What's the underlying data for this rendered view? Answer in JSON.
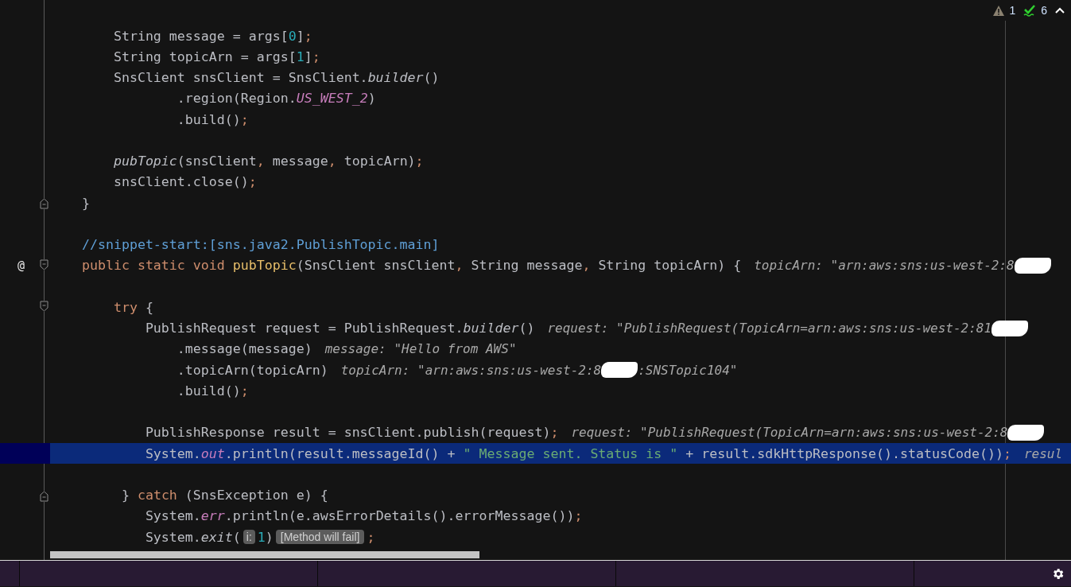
{
  "status": {
    "warnings": "1",
    "checks": "6"
  },
  "blocks": [
    {
      "lines": [
        {
          "segments": [
            {
              "kind": "code",
              "tokens": [
                {
                  "text": "        String message = args[",
                  "kind": "plain"
                },
                {
                  "text": "0",
                  "kind": "number"
                },
                {
                  "text": "]",
                  "kind": "plain"
                },
                {
                  "text": ";",
                  "kind": "punct"
                }
              ]
            }
          ]
        },
        {
          "segments": [
            {
              "kind": "code",
              "tokens": [
                {
                  "text": "        String topicArn = args[",
                  "kind": "plain"
                },
                {
                  "text": "1",
                  "kind": "number"
                },
                {
                  "text": "]",
                  "kind": "plain"
                },
                {
                  "text": ";",
                  "kind": "punct"
                }
              ]
            }
          ]
        },
        {
          "segments": [
            {
              "kind": "code",
              "tokens": [
                {
                  "text": "        SnsClient snsClient = SnsClient.",
                  "kind": "plain"
                },
                {
                  "text": "builder",
                  "kind": "call"
                },
                {
                  "text": "()",
                  "kind": "plain"
                }
              ]
            }
          ]
        },
        {
          "segments": [
            {
              "kind": "code",
              "tokens": [
                {
                  "text": "                .region(Region.",
                  "kind": "plain"
                },
                {
                  "text": "US_WEST_2",
                  "kind": "field"
                },
                {
                  "text": ")",
                  "kind": "plain"
                }
              ]
            }
          ]
        },
        {
          "segments": [
            {
              "kind": "code",
              "tokens": [
                {
                  "text": "                .build()",
                  "kind": "plain"
                },
                {
                  "text": ";",
                  "kind": "punct"
                }
              ]
            }
          ]
        }
      ]
    },
    {
      "lines": [
        {
          "segments": [
            {
              "kind": "code",
              "tokens": [
                {
                  "text": "        pubTopic",
                  "kind": "call"
                },
                {
                  "text": "(snsClient",
                  "kind": "plain"
                },
                {
                  "text": ",",
                  "kind": "punct"
                },
                {
                  "text": " message",
                  "kind": "plain"
                },
                {
                  "text": ",",
                  "kind": "punct"
                },
                {
                  "text": " topicArn)",
                  "kind": "plain"
                },
                {
                  "text": ";",
                  "kind": "punct"
                }
              ]
            }
          ]
        },
        {
          "segments": [
            {
              "kind": "code",
              "tokens": [
                {
                  "text": "        snsClient.close()",
                  "kind": "plain"
                },
                {
                  "text": ";",
                  "kind": "punct"
                }
              ]
            }
          ]
        },
        {
          "marker": {
            "kind": "fold_end"
          },
          "segments": [
            {
              "kind": "code",
              "tokens": [
                {
                  "text": "    }",
                  "kind": "plain"
                }
              ]
            }
          ]
        }
      ]
    },
    {
      "lines": [
        {
          "segments": [
            {
              "kind": "code",
              "tokens": [
                {
                  "text": "    //snippet-start:[sns.java2.PublishTopic.main]",
                  "kind": "comment"
                }
              ]
            }
          ]
        },
        {
          "marker": {
            "kind": "fold_start"
          },
          "gutter": "@",
          "segments": [
            {
              "kind": "code",
              "tokens": [
                {
                  "text": "    public static void ",
                  "kind": "keyword"
                },
                {
                  "text": "pubTopic",
                  "kind": "declaration"
                },
                {
                  "text": "(SnsClient snsClient",
                  "kind": "plain"
                },
                {
                  "text": ",",
                  "kind": "punct"
                },
                {
                  "text": " String message",
                  "kind": "plain"
                },
                {
                  "text": ",",
                  "kind": "punct"
                },
                {
                  "text": " String topicArn) {",
                  "kind": "plain"
                }
              ]
            },
            {
              "kind": "hint",
              "text": "topicArn: \"arn:aws:sns:us-west-2:8"
            },
            {
              "kind": "redaction"
            }
          ]
        }
      ]
    },
    {
      "lines": [
        {
          "marker": {
            "kind": "fold_start"
          },
          "segments": [
            {
              "kind": "code",
              "tokens": [
                {
                  "text": "        try ",
                  "kind": "keyword"
                },
                {
                  "text": "{",
                  "kind": "plain"
                }
              ]
            }
          ]
        },
        {
          "segments": [
            {
              "kind": "code",
              "tokens": [
                {
                  "text": "            PublishRequest request = PublishRequest.",
                  "kind": "plain"
                },
                {
                  "text": "builder",
                  "kind": "call"
                },
                {
                  "text": "()",
                  "kind": "plain"
                }
              ]
            },
            {
              "kind": "hint",
              "text": "request: \"PublishRequest(TopicArn=arn:aws:sns:us-west-2:81"
            },
            {
              "kind": "redaction"
            }
          ]
        },
        {
          "segments": [
            {
              "kind": "code",
              "tokens": [
                {
                  "text": "                .message(message)",
                  "kind": "plain"
                }
              ]
            },
            {
              "kind": "hint",
              "text": "message: \"Hello from AWS\""
            }
          ]
        },
        {
          "segments": [
            {
              "kind": "code",
              "tokens": [
                {
                  "text": "                .topicArn(topicArn)",
                  "kind": "plain"
                }
              ]
            },
            {
              "kind": "hint",
              "text": "topicArn: \"arn:aws:sns:us-west-2:8"
            },
            {
              "kind": "redaction"
            },
            {
              "kind": "hint",
              "text": ":SNSTopic104\""
            }
          ]
        },
        {
          "segments": [
            {
              "kind": "code",
              "tokens": [
                {
                  "text": "                .build()",
                  "kind": "plain"
                },
                {
                  "text": ";",
                  "kind": "punct"
                }
              ]
            }
          ]
        }
      ]
    },
    {
      "lines": [
        {
          "segments": [
            {
              "kind": "code",
              "tokens": [
                {
                  "text": "            PublishResponse result = snsClient.publish(request)",
                  "kind": "plain"
                },
                {
                  "text": ";",
                  "kind": "punct"
                }
              ]
            },
            {
              "kind": "hint",
              "text": "request: \"PublishRequest(TopicArn=arn:aws:sns:us-west-2:8"
            },
            {
              "kind": "redaction"
            }
          ]
        },
        {
          "highlighted": true,
          "segments": [
            {
              "kind": "code",
              "tokens": [
                {
                  "text": "            System.",
                  "kind": "plain"
                },
                {
                  "text": "out",
                  "kind": "field"
                },
                {
                  "text": ".println(result.messageId() + ",
                  "kind": "plain"
                },
                {
                  "text": "\" Message sent. Status is \"",
                  "kind": "string"
                },
                {
                  "text": " + result.sdkHttpResponse().statusCode())",
                  "kind": "plain"
                },
                {
                  "text": ";",
                  "kind": "punct"
                }
              ]
            },
            {
              "kind": "hint",
              "text": "resul"
            }
          ]
        }
      ]
    },
    {
      "lines": [
        {
          "marker": {
            "kind": "fold_end"
          },
          "segments": [
            {
              "kind": "code",
              "tokens": [
                {
                  "text": "         } ",
                  "kind": "plain"
                },
                {
                  "text": "catch ",
                  "kind": "keyword"
                },
                {
                  "text": "(SnsException e) {",
                  "kind": "plain"
                }
              ]
            }
          ]
        },
        {
          "segments": [
            {
              "kind": "code",
              "tokens": [
                {
                  "text": "            System.",
                  "kind": "plain"
                },
                {
                  "text": "err",
                  "kind": "field"
                },
                {
                  "text": ".println(e.awsErrorDetails().errorMessage())",
                  "kind": "plain"
                },
                {
                  "text": ";",
                  "kind": "punct"
                }
              ]
            }
          ]
        },
        {
          "segments": [
            {
              "kind": "code",
              "tokens": [
                {
                  "text": "            System.",
                  "kind": "plain"
                },
                {
                  "text": "exit",
                  "kind": "call"
                },
                {
                  "text": "(",
                  "kind": "plain"
                }
              ]
            },
            {
              "kind": "param",
              "text": "i:"
            },
            {
              "kind": "code",
              "tokens": [
                {
                  "text": "1",
                  "kind": "number"
                },
                {
                  "text": ")",
                  "kind": "plain"
                }
              ]
            },
            {
              "kind": "badge",
              "text": "[Method will fail]"
            },
            {
              "kind": "code",
              "tokens": [
                {
                  "text": ";",
                  "kind": "punct"
                }
              ]
            }
          ]
        }
      ]
    }
  ]
}
